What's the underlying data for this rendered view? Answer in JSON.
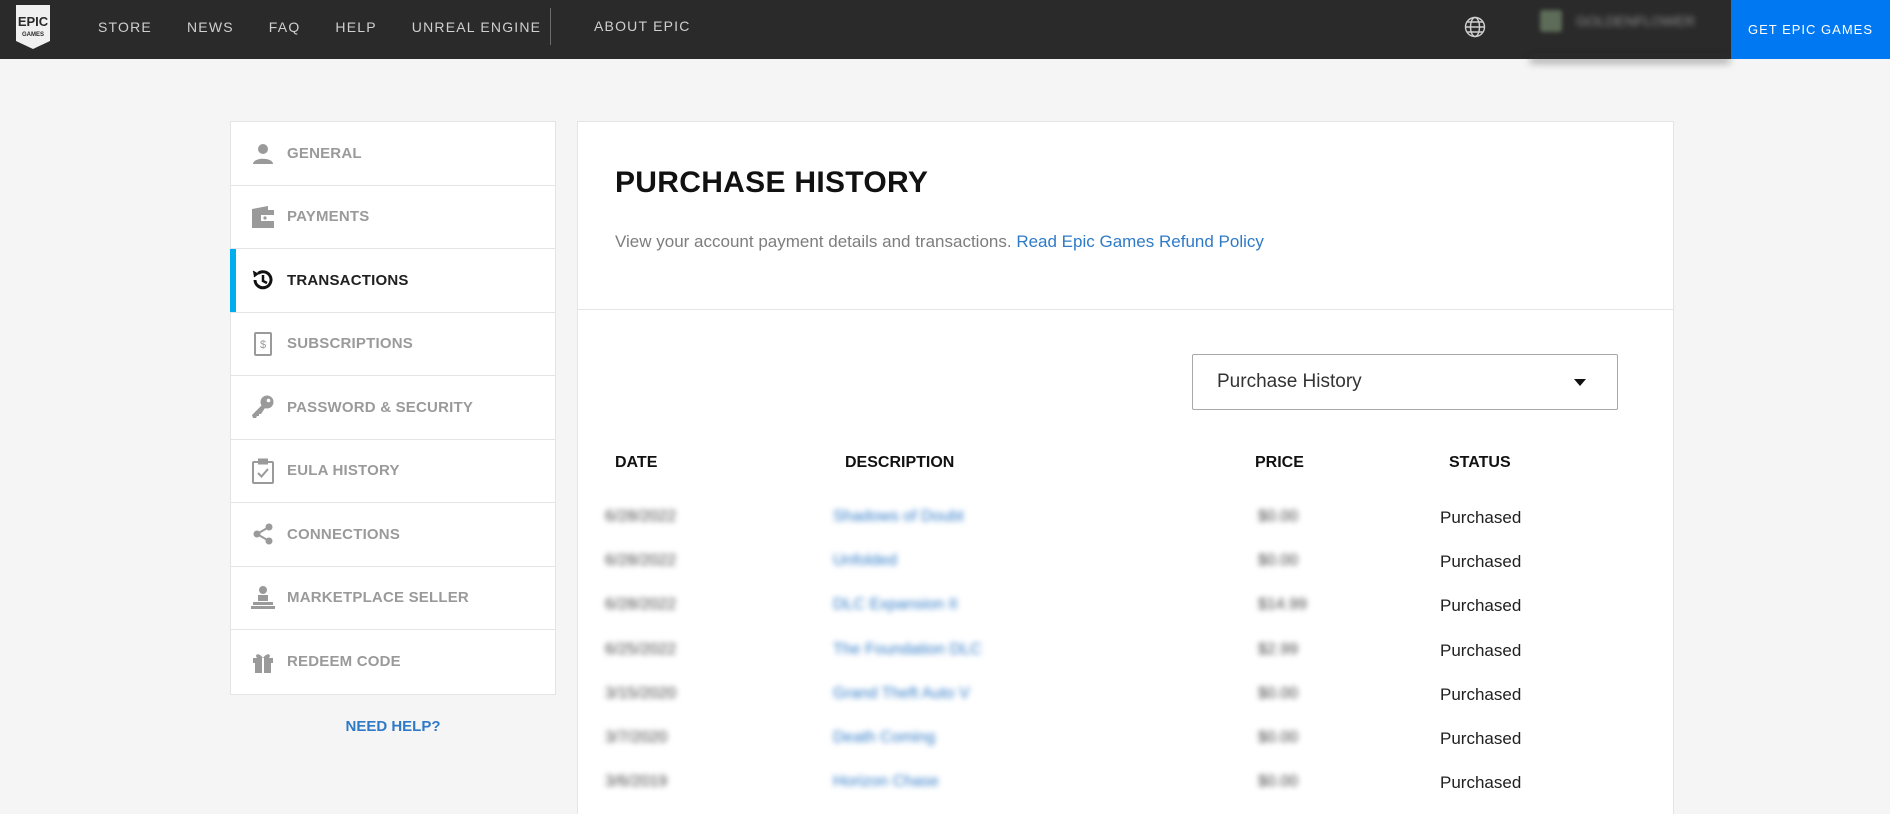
{
  "topnav": {
    "logo_text_1": "EPIC",
    "logo_text_2": "GAMES",
    "links": [
      "STORE",
      "NEWS",
      "FAQ",
      "HELP",
      "UNREAL ENGINE"
    ],
    "about": "ABOUT EPIC",
    "username": "GOLDENFLOWER",
    "cta": "GET EPIC GAMES"
  },
  "sidebar": {
    "items": [
      {
        "label": "GENERAL",
        "icon": "person-icon"
      },
      {
        "label": "PAYMENTS",
        "icon": "wallet-icon"
      },
      {
        "label": "TRANSACTIONS",
        "icon": "history-icon",
        "active": true
      },
      {
        "label": "SUBSCRIPTIONS",
        "icon": "receipt-dollar-icon"
      },
      {
        "label": "PASSWORD & SECURITY",
        "icon": "key-icon"
      },
      {
        "label": "EULA HISTORY",
        "icon": "clipboard-check-icon"
      },
      {
        "label": "CONNECTIONS",
        "icon": "share-icon"
      },
      {
        "label": "MARKETPLACE SELLER",
        "icon": "seller-icon"
      },
      {
        "label": "REDEEM CODE",
        "icon": "gift-icon"
      }
    ],
    "need_help": "NEED HELP?"
  },
  "main": {
    "title": "PURCHASE HISTORY",
    "subtitle": "View your account payment details and transactions.",
    "refund_link": "Read Epic Games Refund Policy",
    "filter_value": "Purchase History",
    "columns": [
      "DATE",
      "DESCRIPTION",
      "PRICE",
      "STATUS"
    ],
    "rows": [
      {
        "date": "6/28/2022",
        "description": "Shadows of Doubt",
        "price": "$0.00",
        "status": "Purchased"
      },
      {
        "date": "6/28/2022",
        "description": "Unfolded",
        "price": "$0.00",
        "status": "Purchased"
      },
      {
        "date": "6/28/2022",
        "description": "DLC Expansion II",
        "price": "$14.99",
        "status": "Purchased"
      },
      {
        "date": "6/25/2022",
        "description": "The Foundation DLC",
        "price": "$2.99",
        "status": "Purchased"
      },
      {
        "date": "3/15/2020",
        "description": "Grand Theft Auto V",
        "price": "$0.00",
        "status": "Purchased"
      },
      {
        "date": "3/7/2020",
        "description": "Death Coming",
        "price": "$0.00",
        "status": "Purchased"
      },
      {
        "date": "3/6/2019",
        "description": "Horizon Chase",
        "price": "$0.00",
        "status": "Purchased"
      }
    ]
  },
  "colors": {
    "nav_bg": "#2a2a2a",
    "cta_bg": "#0078f2",
    "active_accent": "#00aeef",
    "link": "#2f7ac7",
    "page_bg": "#f5f5f5"
  }
}
